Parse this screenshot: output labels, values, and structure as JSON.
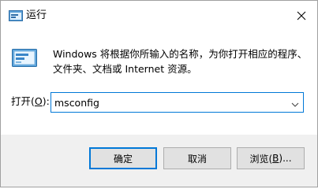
{
  "window": {
    "title": "运行",
    "close_glyph": "✕"
  },
  "message": {
    "line1": "Windows 将根据你所输入的名称，为你打开相应的程序、",
    "line2": "文件夹、文档或 Internet 资源。"
  },
  "open": {
    "label_prefix": "打开(",
    "label_key": "O",
    "label_suffix": "):",
    "value": "msconfig"
  },
  "buttons": {
    "ok": "确定",
    "cancel": "取消",
    "browse_prefix": "浏览(",
    "browse_key": "B",
    "browse_suffix": ")..."
  },
  "colors": {
    "accent": "#0078d7",
    "footer_bg": "#f0f0f0",
    "button_bg": "#e1e1e1"
  },
  "icons": {
    "app": "run-dialog-icon",
    "close": "close-icon",
    "run": "run-icon",
    "dropdown": "chevron-down-icon"
  }
}
